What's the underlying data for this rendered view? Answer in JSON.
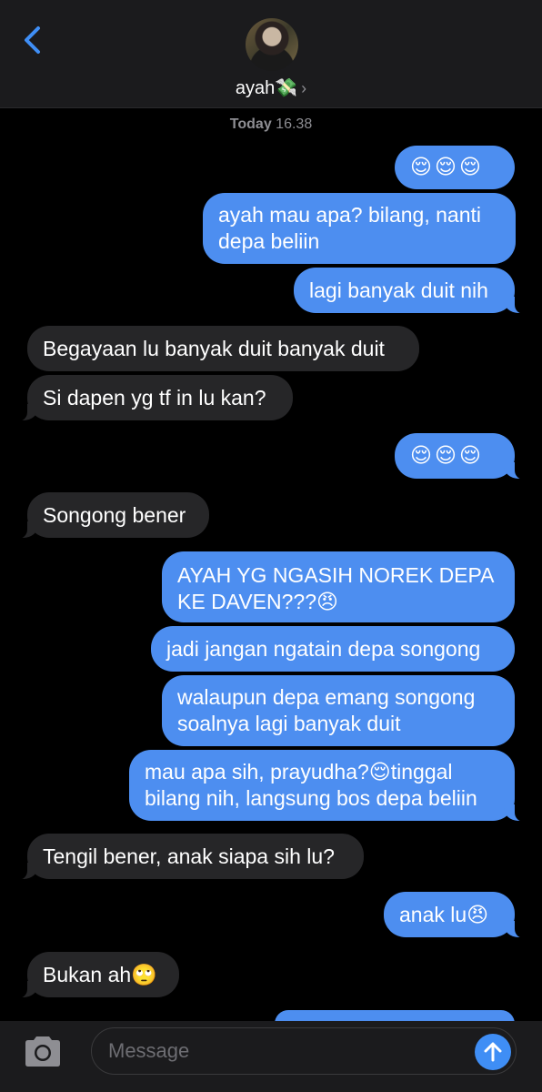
{
  "header": {
    "contact_name": "ayah💸",
    "chevron": "›",
    "back_icon": "chevron-left-icon"
  },
  "timestamp": {
    "day": "Today",
    "time": "16.38"
  },
  "messages": [
    {
      "dir": "out",
      "text": "😌😌😌"
    },
    {
      "dir": "out",
      "text": "ayah mau apa? bilang, nanti depa beliin"
    },
    {
      "dir": "out",
      "text": "lagi banyak duit nih"
    },
    {
      "dir": "in",
      "text": "Begayaan lu banyak duit banyak duit"
    },
    {
      "dir": "in",
      "text": "Si dapen yg tf in lu kan?"
    },
    {
      "dir": "out",
      "text": "😌😌😌"
    },
    {
      "dir": "in",
      "text": "Songong bener"
    },
    {
      "dir": "out",
      "text": "AYAH YG NGASIH NOREK DEPA KE DAVEN???😠"
    },
    {
      "dir": "out",
      "text": "jadi jangan ngatain depa songong"
    },
    {
      "dir": "out",
      "text": "walaupun depa emang songong soalnya lagi banyak duit"
    },
    {
      "dir": "out",
      "text": "mau apa sih, prayudha?😌tinggal bilang nih, langsung bos depa beliin"
    },
    {
      "dir": "in",
      "text": "Tengil bener, anak siapa sih lu?"
    },
    {
      "dir": "out",
      "text": "anak lu😠"
    },
    {
      "dir": "in",
      "text": "Bukan ah🙄"
    }
  ],
  "lines": {
    "m1": [
      "ayah mau apa? bilang, nanti",
      "depa beliin"
    ],
    "m7": [
      "AYAH YG NGASIH NOREK DEPA",
      "KE DAVEN???😠"
    ],
    "m9": [
      "walaupun depa emang songong",
      "soalnya lagi banyak duit"
    ],
    "m10": [
      "mau apa sih, prayudha?😌tinggal",
      "bilang nih, langsung bos depa beliin"
    ]
  },
  "input": {
    "placeholder": "Message",
    "value": ""
  },
  "icons": {
    "camera": "camera-icon",
    "send": "arrow-up-icon"
  },
  "colors": {
    "outgoing": "#4d8ef0",
    "incoming": "#262628",
    "accent": "#3f8ef5"
  }
}
